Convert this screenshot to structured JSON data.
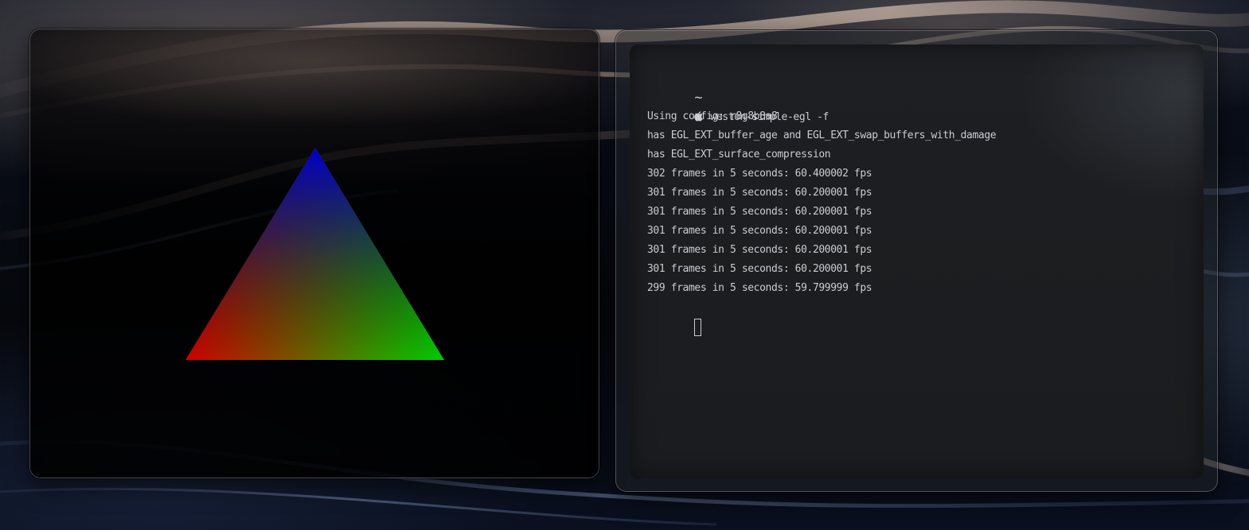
{
  "colors": {
    "triangle_top": "#0000cc",
    "triangle_left": "#cc0000",
    "triangle_right": "#00cc00",
    "terminal_text": "#c9ccd1",
    "terminal_bg": "#1c1e21"
  },
  "terminal": {
    "prompt_dir": "~",
    "prompt_icon": "apple-icon",
    "command": "weston-simple-egl -f",
    "output": [
      "Using config: r8g8b8a8",
      "has EGL_EXT_buffer_age and EGL_EXT_swap_buffers_with_damage",
      "has EGL_EXT_surface_compression",
      "302 frames in 5 seconds: 60.400002 fps",
      "301 frames in 5 seconds: 60.200001 fps",
      "301 frames in 5 seconds: 60.200001 fps",
      "301 frames in 5 seconds: 60.200001 fps",
      "301 frames in 5 seconds: 60.200001 fps",
      "301 frames in 5 seconds: 60.200001 fps",
      "299 frames in 5 seconds: 59.799999 fps"
    ]
  }
}
